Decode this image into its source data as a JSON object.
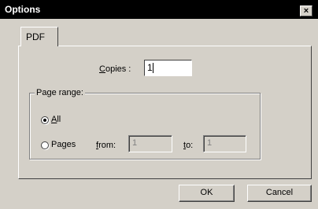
{
  "window": {
    "title": "Options",
    "close_label": "×"
  },
  "tabs": [
    {
      "label": "PDF",
      "selected": true
    }
  ],
  "copies": {
    "label": "Copies :",
    "value": "1"
  },
  "page_range": {
    "group_label": "Page range:",
    "options": [
      {
        "label": "All",
        "selected": true
      },
      {
        "label": "Pages",
        "selected": false
      }
    ],
    "from_label": "from:",
    "from_value": "1",
    "to_label": "to:",
    "to_value": "1"
  },
  "buttons": {
    "ok_label": "OK",
    "cancel_label": "Cancel"
  },
  "colors": {
    "dialog_background": "#d4d0c8",
    "title_bar": "#000000",
    "disabled_text": "#808080"
  }
}
